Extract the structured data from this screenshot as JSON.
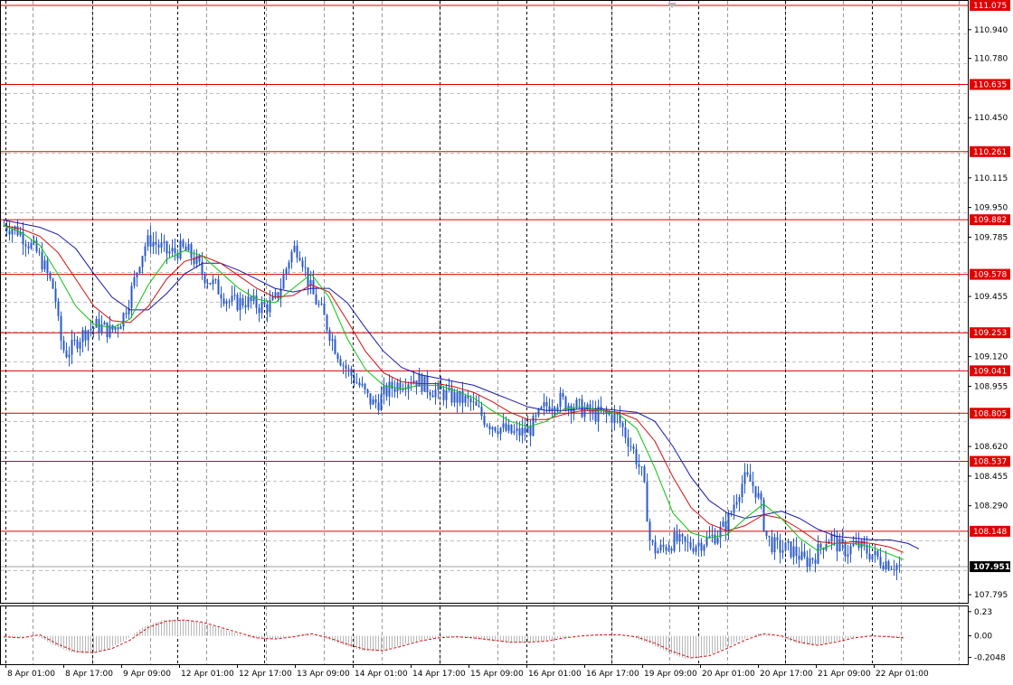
{
  "chart_data": {
    "type": "candlestick",
    "grid": true,
    "ylim": [
      107.75,
      111.1
    ],
    "osc_ylim": [
      -0.27,
      0.28
    ],
    "y_ticks": [
      110.94,
      110.78,
      110.45,
      110.115,
      109.95,
      109.785,
      109.455,
      109.12,
      108.955,
      108.62,
      108.455,
      108.29,
      107.795
    ],
    "y_tick_labels": [
      "110.940",
      "110.780",
      "110.450",
      "110.115",
      "109.950",
      "109.785",
      "109.455",
      "109.120",
      "108.955",
      "108.620",
      "108.455",
      "108.290",
      "107.795"
    ],
    "osc_ticks": [
      0.23,
      0.0,
      -0.2048
    ],
    "osc_tick_labels": [
      "0.23",
      "0.00",
      "-0.2048"
    ],
    "x_labels": [
      "8 Apr 01:00",
      "8 Apr 17:00",
      "9 Apr 09:00",
      "12 Apr 01:00",
      "12 Apr 17:00",
      "13 Apr 09:00",
      "14 Apr 01:00",
      "14 Apr 17:00",
      "15 Apr 09:00",
      "16 Apr 01:00",
      "16 Apr 17:00",
      "19 Apr 09:00",
      "20 Apr 01:00",
      "20 Apr 17:00",
      "21 Apr 09:00",
      "22 Apr 01:00"
    ],
    "levels": [
      {
        "value": 111.075,
        "label": "111.075"
      },
      {
        "value": 110.635,
        "label": "110.635"
      },
      {
        "value": 110.261,
        "label": "110.261"
      },
      {
        "value": 109.882,
        "label": "109.882"
      },
      {
        "value": 109.578,
        "label": "109.578"
      },
      {
        "value": 109.253,
        "label": "109.253"
      },
      {
        "value": 109.041,
        "label": "109.041"
      },
      {
        "value": 108.805,
        "label": "108.805"
      },
      {
        "value": 108.537,
        "label": "108.537"
      },
      {
        "value": 108.148,
        "label": "108.148"
      }
    ],
    "current_price": {
      "value": 107.951,
      "label": "107.951"
    },
    "price_series": [
      [
        0,
        109.85
      ],
      [
        8,
        109.84
      ],
      [
        16,
        109.82
      ],
      [
        26,
        109.76
      ],
      [
        36,
        109.7
      ],
      [
        44,
        109.63
      ],
      [
        50,
        109.55
      ],
      [
        56,
        109.48
      ],
      [
        60,
        109.3
      ],
      [
        64,
        109.18
      ],
      [
        68,
        109.14
      ],
      [
        74,
        109.16
      ],
      [
        82,
        109.22
      ],
      [
        92,
        109.27
      ],
      [
        102,
        109.29
      ],
      [
        110,
        109.28
      ],
      [
        118,
        109.26
      ],
      [
        126,
        109.3
      ],
      [
        132,
        109.35
      ],
      [
        138,
        109.44
      ],
      [
        144,
        109.54
      ],
      [
        150,
        109.66
      ],
      [
        156,
        109.74
      ],
      [
        162,
        109.77
      ],
      [
        170,
        109.74
      ],
      [
        180,
        109.7
      ],
      [
        188,
        109.7
      ],
      [
        196,
        109.72
      ],
      [
        204,
        109.7
      ],
      [
        212,
        109.65
      ],
      [
        220,
        109.58
      ],
      [
        230,
        109.53
      ],
      [
        240,
        109.48
      ],
      [
        250,
        109.42
      ],
      [
        258,
        109.42
      ],
      [
        266,
        109.43
      ],
      [
        274,
        109.42
      ],
      [
        282,
        109.4
      ],
      [
        290,
        109.4
      ],
      [
        298,
        109.42
      ],
      [
        304,
        109.48
      ],
      [
        310,
        109.58
      ],
      [
        316,
        109.68
      ],
      [
        322,
        109.73
      ],
      [
        328,
        109.7
      ],
      [
        334,
        109.58
      ],
      [
        340,
        109.48
      ],
      [
        346,
        109.42
      ],
      [
        352,
        109.36
      ],
      [
        358,
        109.28
      ],
      [
        364,
        109.2
      ],
      [
        370,
        109.13
      ],
      [
        376,
        109.07
      ],
      [
        382,
        109.03
      ],
      [
        390,
        108.98
      ],
      [
        396,
        108.94
      ],
      [
        402,
        108.89
      ],
      [
        408,
        108.86
      ],
      [
        414,
        108.87
      ],
      [
        420,
        108.91
      ],
      [
        426,
        108.94
      ],
      [
        432,
        108.96
      ],
      [
        440,
        108.98
      ],
      [
        446,
        108.99
      ],
      [
        452,
        109.0
      ],
      [
        460,
        108.98
      ],
      [
        468,
        108.95
      ],
      [
        476,
        108.93
      ],
      [
        484,
        108.92
      ],
      [
        492,
        108.9
      ],
      [
        500,
        108.89
      ],
      [
        508,
        108.88
      ],
      [
        516,
        108.86
      ],
      [
        524,
        108.82
      ],
      [
        530,
        108.78
      ],
      [
        536,
        108.75
      ],
      [
        542,
        108.74
      ],
      [
        550,
        108.72
      ],
      [
        558,
        108.7
      ],
      [
        566,
        108.69
      ],
      [
        574,
        108.7
      ],
      [
        582,
        108.72
      ],
      [
        590,
        108.78
      ],
      [
        598,
        108.84
      ],
      [
        606,
        108.87
      ],
      [
        614,
        108.88
      ],
      [
        622,
        108.86
      ],
      [
        630,
        108.85
      ],
      [
        638,
        108.83
      ],
      [
        646,
        108.81
      ],
      [
        654,
        108.8
      ],
      [
        662,
        108.8
      ],
      [
        670,
        108.79
      ],
      [
        678,
        108.78
      ],
      [
        686,
        108.7
      ],
      [
        694,
        108.62
      ],
      [
        700,
        108.54
      ],
      [
        706,
        108.45
      ],
      [
        710,
        108.3
      ],
      [
        714,
        108.1
      ],
      [
        718,
        108.05
      ],
      [
        724,
        108.04
      ],
      [
        730,
        108.06
      ],
      [
        736,
        108.08
      ],
      [
        742,
        108.1
      ],
      [
        748,
        108.08
      ],
      [
        754,
        108.07
      ],
      [
        760,
        108.07
      ],
      [
        766,
        108.08
      ],
      [
        772,
        108.09
      ],
      [
        778,
        108.1
      ],
      [
        784,
        108.12
      ],
      [
        790,
        108.14
      ],
      [
        796,
        108.17
      ],
      [
        802,
        108.22
      ],
      [
        808,
        108.32
      ],
      [
        814,
        108.4
      ],
      [
        820,
        108.44
      ],
      [
        826,
        108.42
      ],
      [
        832,
        108.37
      ],
      [
        838,
        108.26
      ],
      [
        842,
        108.13
      ],
      [
        848,
        108.08
      ],
      [
        854,
        108.06
      ],
      [
        860,
        108.05
      ],
      [
        866,
        108.05
      ],
      [
        872,
        108.04
      ],
      [
        878,
        108.02
      ],
      [
        884,
        107.98
      ],
      [
        890,
        107.99
      ],
      [
        896,
        108.01
      ],
      [
        902,
        108.05
      ],
      [
        908,
        108.1
      ],
      [
        914,
        108.12
      ],
      [
        920,
        108.08
      ],
      [
        926,
        108.05
      ],
      [
        932,
        108.04
      ],
      [
        938,
        108.06
      ],
      [
        944,
        108.07
      ],
      [
        950,
        108.05
      ],
      [
        956,
        108.03
      ],
      [
        962,
        108.01
      ],
      [
        968,
        107.99
      ],
      [
        974,
        107.98
      ],
      [
        980,
        107.97
      ],
      [
        986,
        107.96
      ],
      [
        992,
        107.95
      ]
    ],
    "ma_green": [
      [
        0,
        109.85
      ],
      [
        20,
        109.81
      ],
      [
        40,
        109.74
      ],
      [
        60,
        109.58
      ],
      [
        80,
        109.4
      ],
      [
        100,
        109.3
      ],
      [
        120,
        109.28
      ],
      [
        140,
        109.33
      ],
      [
        160,
        109.52
      ],
      [
        180,
        109.66
      ],
      [
        200,
        109.71
      ],
      [
        220,
        109.68
      ],
      [
        240,
        109.59
      ],
      [
        260,
        109.5
      ],
      [
        280,
        109.44
      ],
      [
        300,
        109.42
      ],
      [
        320,
        109.5
      ],
      [
        340,
        109.58
      ],
      [
        360,
        109.45
      ],
      [
        380,
        109.22
      ],
      [
        400,
        109.05
      ],
      [
        420,
        108.96
      ],
      [
        440,
        108.94
      ],
      [
        460,
        108.96
      ],
      [
        480,
        108.96
      ],
      [
        500,
        108.93
      ],
      [
        520,
        108.89
      ],
      [
        540,
        108.82
      ],
      [
        560,
        108.76
      ],
      [
        580,
        108.73
      ],
      [
        600,
        108.76
      ],
      [
        620,
        108.83
      ],
      [
        640,
        108.84
      ],
      [
        660,
        108.82
      ],
      [
        680,
        108.8
      ],
      [
        700,
        108.72
      ],
      [
        720,
        108.5
      ],
      [
        740,
        108.25
      ],
      [
        760,
        108.14
      ],
      [
        780,
        108.11
      ],
      [
        800,
        108.13
      ],
      [
        820,
        108.22
      ],
      [
        840,
        108.3
      ],
      [
        860,
        108.22
      ],
      [
        880,
        108.11
      ],
      [
        900,
        108.04
      ],
      [
        920,
        108.08
      ],
      [
        940,
        108.08
      ],
      [
        960,
        108.06
      ],
      [
        980,
        108.02
      ],
      [
        995,
        107.99
      ]
    ],
    "ma_red": [
      [
        0,
        109.85
      ],
      [
        20,
        109.83
      ],
      [
        40,
        109.79
      ],
      [
        60,
        109.7
      ],
      [
        80,
        109.55
      ],
      [
        100,
        109.4
      ],
      [
        120,
        109.32
      ],
      [
        140,
        109.31
      ],
      [
        160,
        109.4
      ],
      [
        180,
        109.55
      ],
      [
        200,
        109.65
      ],
      [
        220,
        109.68
      ],
      [
        240,
        109.64
      ],
      [
        260,
        109.57
      ],
      [
        280,
        109.5
      ],
      [
        300,
        109.45
      ],
      [
        320,
        109.46
      ],
      [
        340,
        109.52
      ],
      [
        360,
        109.48
      ],
      [
        380,
        109.32
      ],
      [
        400,
        109.15
      ],
      [
        420,
        109.03
      ],
      [
        440,
        108.98
      ],
      [
        460,
        108.97
      ],
      [
        480,
        108.97
      ],
      [
        500,
        108.95
      ],
      [
        520,
        108.92
      ],
      [
        540,
        108.87
      ],
      [
        560,
        108.81
      ],
      [
        580,
        108.77
      ],
      [
        600,
        108.77
      ],
      [
        620,
        108.8
      ],
      [
        640,
        108.82
      ],
      [
        660,
        108.82
      ],
      [
        680,
        108.81
      ],
      [
        700,
        108.77
      ],
      [
        720,
        108.65
      ],
      [
        740,
        108.45
      ],
      [
        760,
        108.28
      ],
      [
        780,
        108.19
      ],
      [
        800,
        108.15
      ],
      [
        820,
        108.18
      ],
      [
        840,
        108.24
      ],
      [
        860,
        108.22
      ],
      [
        880,
        108.16
      ],
      [
        900,
        108.09
      ],
      [
        920,
        108.08
      ],
      [
        940,
        108.09
      ],
      [
        960,
        108.08
      ],
      [
        980,
        108.06
      ],
      [
        995,
        108.03
      ]
    ],
    "ma_blue": [
      [
        0,
        109.88
      ],
      [
        20,
        109.86
      ],
      [
        40,
        109.84
      ],
      [
        60,
        109.8
      ],
      [
        80,
        109.72
      ],
      [
        100,
        109.58
      ],
      [
        120,
        109.45
      ],
      [
        140,
        109.38
      ],
      [
        160,
        109.38
      ],
      [
        180,
        109.47
      ],
      [
        200,
        109.58
      ],
      [
        220,
        109.64
      ],
      [
        240,
        109.64
      ],
      [
        260,
        109.6
      ],
      [
        280,
        109.55
      ],
      [
        300,
        109.5
      ],
      [
        320,
        109.48
      ],
      [
        340,
        109.5
      ],
      [
        360,
        109.5
      ],
      [
        380,
        109.42
      ],
      [
        400,
        109.28
      ],
      [
        420,
        109.15
      ],
      [
        440,
        109.06
      ],
      [
        460,
        109.02
      ],
      [
        480,
        109.0
      ],
      [
        500,
        108.98
      ],
      [
        520,
        108.96
      ],
      [
        540,
        108.92
      ],
      [
        560,
        108.88
      ],
      [
        580,
        108.84
      ],
      [
        600,
        108.82
      ],
      [
        620,
        108.82
      ],
      [
        640,
        108.83
      ],
      [
        660,
        108.83
      ],
      [
        680,
        108.82
      ],
      [
        700,
        108.81
      ],
      [
        720,
        108.76
      ],
      [
        740,
        108.62
      ],
      [
        760,
        108.45
      ],
      [
        780,
        108.32
      ],
      [
        800,
        108.25
      ],
      [
        820,
        108.22
      ],
      [
        840,
        108.24
      ],
      [
        860,
        108.26
      ],
      [
        880,
        108.22
      ],
      [
        900,
        108.16
      ],
      [
        920,
        108.12
      ],
      [
        940,
        108.11
      ],
      [
        960,
        108.1
      ],
      [
        980,
        108.1
      ],
      [
        1000,
        108.08
      ],
      [
        1012,
        108.05
      ]
    ],
    "osc_signal": [
      [
        0,
        -0.01
      ],
      [
        20,
        -0.02
      ],
      [
        40,
        0.01
      ],
      [
        60,
        -0.08
      ],
      [
        80,
        -0.15
      ],
      [
        100,
        -0.16
      ],
      [
        120,
        -0.12
      ],
      [
        140,
        -0.04
      ],
      [
        160,
        0.08
      ],
      [
        180,
        0.14
      ],
      [
        200,
        0.15
      ],
      [
        220,
        0.13
      ],
      [
        240,
        0.08
      ],
      [
        260,
        0.03
      ],
      [
        280,
        -0.02
      ],
      [
        300,
        -0.03
      ],
      [
        320,
        -0.01
      ],
      [
        340,
        0.02
      ],
      [
        360,
        -0.02
      ],
      [
        380,
        -0.08
      ],
      [
        400,
        -0.13
      ],
      [
        420,
        -0.14
      ],
      [
        440,
        -0.1
      ],
      [
        460,
        -0.05
      ],
      [
        480,
        -0.02
      ],
      [
        500,
        -0.01
      ],
      [
        520,
        -0.02
      ],
      [
        540,
        -0.04
      ],
      [
        560,
        -0.06
      ],
      [
        580,
        -0.06
      ],
      [
        600,
        -0.05
      ],
      [
        620,
        -0.02
      ],
      [
        640,
        0.0
      ],
      [
        660,
        0.01
      ],
      [
        680,
        0.01
      ],
      [
        700,
        -0.01
      ],
      [
        720,
        -0.07
      ],
      [
        740,
        -0.15
      ],
      [
        760,
        -0.21
      ],
      [
        780,
        -0.19
      ],
      [
        800,
        -0.12
      ],
      [
        820,
        -0.04
      ],
      [
        840,
        0.02
      ],
      [
        860,
        0.0
      ],
      [
        880,
        -0.06
      ],
      [
        900,
        -0.09
      ],
      [
        920,
        -0.06
      ],
      [
        940,
        -0.02
      ],
      [
        960,
        0.0
      ],
      [
        980,
        -0.01
      ],
      [
        995,
        -0.02
      ]
    ]
  }
}
